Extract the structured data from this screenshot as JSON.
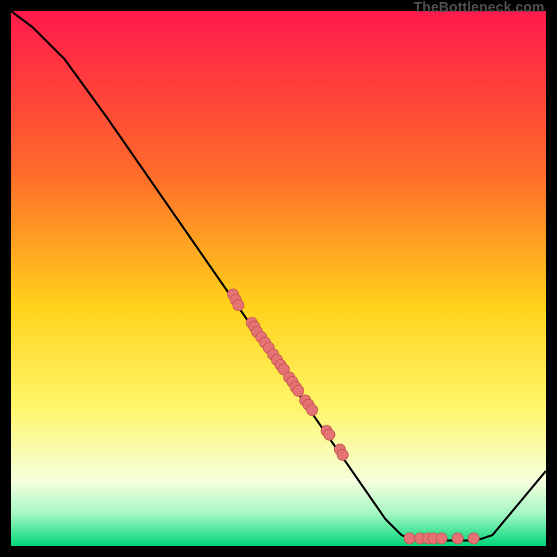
{
  "watermark": "TheBottleneck.com",
  "colors": {
    "dot_fill": "#e57373",
    "dot_stroke": "#c0504d",
    "line": "#000000",
    "grad_top": "#ff1a4b",
    "grad_mid1": "#ff6a2a",
    "grad_mid2": "#ffd21a",
    "grad_mid3": "#fff66a",
    "grad_mid4": "#f5ffde",
    "grad_mid5": "#a4f7c4",
    "grad_bottom": "#00d67a"
  },
  "chart_data": {
    "type": "line",
    "title": "",
    "xlabel": "",
    "ylabel": "",
    "xlim": [
      0,
      100
    ],
    "ylim": [
      0,
      100
    ],
    "line_points": [
      {
        "x": 0,
        "y": 100
      },
      {
        "x": 4,
        "y": 97
      },
      {
        "x": 10,
        "y": 91
      },
      {
        "x": 18,
        "y": 80
      },
      {
        "x": 70,
        "y": 5
      },
      {
        "x": 73,
        "y": 2
      },
      {
        "x": 76,
        "y": 1
      },
      {
        "x": 87,
        "y": 1
      },
      {
        "x": 90,
        "y": 2
      },
      {
        "x": 100,
        "y": 14
      }
    ],
    "scatter_points": [
      {
        "x": 41.5,
        "y": 47.0
      },
      {
        "x": 42.0,
        "y": 46.0
      },
      {
        "x": 42.5,
        "y": 45.0
      },
      {
        "x": 45.0,
        "y": 41.7
      },
      {
        "x": 45.5,
        "y": 41.0
      },
      {
        "x": 46.0,
        "y": 40.0
      },
      {
        "x": 46.8,
        "y": 39.0
      },
      {
        "x": 47.5,
        "y": 38.0
      },
      {
        "x": 48.2,
        "y": 37.0
      },
      {
        "x": 49.0,
        "y": 35.8
      },
      {
        "x": 49.7,
        "y": 34.8
      },
      {
        "x": 50.4,
        "y": 33.8
      },
      {
        "x": 51.0,
        "y": 33.0
      },
      {
        "x": 52.0,
        "y": 31.5
      },
      {
        "x": 52.6,
        "y": 30.7
      },
      {
        "x": 53.2,
        "y": 29.7
      },
      {
        "x": 53.7,
        "y": 29.0
      },
      {
        "x": 55.0,
        "y": 27.2
      },
      {
        "x": 55.6,
        "y": 26.4
      },
      {
        "x": 56.3,
        "y": 25.4
      },
      {
        "x": 59.0,
        "y": 21.5
      },
      {
        "x": 59.5,
        "y": 20.8
      },
      {
        "x": 61.5,
        "y": 18.0
      },
      {
        "x": 62.0,
        "y": 17.0
      },
      {
        "x": 74.5,
        "y": 1.4
      },
      {
        "x": 76.5,
        "y": 1.4
      },
      {
        "x": 78.0,
        "y": 1.4
      },
      {
        "x": 79.0,
        "y": 1.4
      },
      {
        "x": 80.5,
        "y": 1.4
      },
      {
        "x": 83.5,
        "y": 1.4
      },
      {
        "x": 86.5,
        "y": 1.4
      }
    ],
    "dot_radius_px": 8
  }
}
